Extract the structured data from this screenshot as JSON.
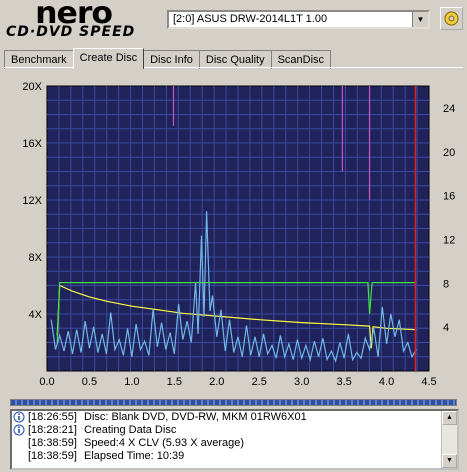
{
  "app": {
    "logo_main": "nero",
    "logo_sub": "CD·DVD SPEED"
  },
  "drive": {
    "selected": "[2:0]  ASUS DRW-2014L1T 1.00"
  },
  "tabs": [
    {
      "label": "Benchmark",
      "active": false
    },
    {
      "label": "Create Disc",
      "active": true
    },
    {
      "label": "Disc Info",
      "active": false
    },
    {
      "label": "Disc Quality",
      "active": false
    },
    {
      "label": "ScanDisc",
      "active": false
    }
  ],
  "chart_data": {
    "type": "line",
    "background": "#20225a",
    "grid": true,
    "x_ticks": [
      "0.0",
      "0.5",
      "1.0",
      "1.5",
      "2.0",
      "2.5",
      "3.0",
      "3.5",
      "4.0",
      "4.5"
    ],
    "y_left_ticks": [
      "4X",
      "8X",
      "12X",
      "16X",
      "20X"
    ],
    "y_right_ticks": [
      "4",
      "8",
      "12",
      "16",
      "20",
      "24"
    ],
    "xlim": [
      0,
      4.5
    ],
    "ylim_left": [
      0,
      20
    ],
    "ylim_right": [
      0,
      26
    ],
    "end_marker_x": 4.34,
    "series": [
      {
        "color": "#ffff40",
        "points": [
          [
            0.12,
            2.5
          ],
          [
            0.15,
            6.0
          ],
          [
            0.3,
            5.6
          ],
          [
            0.5,
            5.2
          ],
          [
            0.7,
            4.9
          ],
          [
            1.0,
            4.55
          ],
          [
            1.3,
            4.3
          ],
          [
            1.6,
            4.05
          ],
          [
            2.0,
            3.85
          ],
          [
            2.5,
            3.6
          ],
          [
            3.0,
            3.4
          ],
          [
            3.5,
            3.25
          ],
          [
            3.8,
            3.15
          ],
          [
            3.82,
            1.6
          ],
          [
            3.84,
            3.1
          ],
          [
            4.0,
            3.0
          ],
          [
            4.35,
            2.9
          ]
        ]
      },
      {
        "color": "#40e040",
        "points": [
          [
            0.12,
            2.0
          ],
          [
            0.15,
            6.2
          ],
          [
            1.0,
            6.2
          ],
          [
            2.0,
            6.2
          ],
          [
            3.0,
            6.2
          ],
          [
            3.5,
            6.2
          ],
          [
            3.78,
            6.2
          ],
          [
            3.8,
            4.0
          ],
          [
            3.83,
            6.2
          ],
          [
            4.35,
            6.2
          ]
        ]
      },
      {
        "color": "#70b8e8",
        "points": [
          [
            0.05,
            3.6
          ],
          [
            0.1,
            1.5
          ],
          [
            0.15,
            2.5
          ],
          [
            0.2,
            1.4
          ],
          [
            0.25,
            2.8
          ],
          [
            0.3,
            1.2
          ],
          [
            0.35,
            2.9
          ],
          [
            0.4,
            1.3
          ],
          [
            0.45,
            3.5
          ],
          [
            0.5,
            1.6
          ],
          [
            0.55,
            3.1
          ],
          [
            0.6,
            1.3
          ],
          [
            0.65,
            2.6
          ],
          [
            0.7,
            1.2
          ],
          [
            0.75,
            4.1
          ],
          [
            0.8,
            1.5
          ],
          [
            0.85,
            2.2
          ],
          [
            0.9,
            1.1
          ],
          [
            0.95,
            3.0
          ],
          [
            1.0,
            1.0
          ],
          [
            1.05,
            3.3
          ],
          [
            1.1,
            1.5
          ],
          [
            1.15,
            2.1
          ],
          [
            1.2,
            1.1
          ],
          [
            1.25,
            4.3
          ],
          [
            1.3,
            1.7
          ],
          [
            1.35,
            3.4
          ],
          [
            1.4,
            1.5
          ],
          [
            1.45,
            2.7
          ],
          [
            1.5,
            1.2
          ],
          [
            1.55,
            4.7
          ],
          [
            1.6,
            2.2
          ],
          [
            1.65,
            3.5
          ],
          [
            1.7,
            2.0
          ],
          [
            1.75,
            6.2
          ],
          [
            1.78,
            2.6
          ],
          [
            1.82,
            9.5
          ],
          [
            1.85,
            3.8
          ],
          [
            1.88,
            11.2
          ],
          [
            1.92,
            4.2
          ],
          [
            1.95,
            5.3
          ],
          [
            2.0,
            2.4
          ],
          [
            2.05,
            4.3
          ],
          [
            2.1,
            1.4
          ],
          [
            2.15,
            3.6
          ],
          [
            2.2,
            1.3
          ],
          [
            2.25,
            2.4
          ],
          [
            2.3,
            1.0
          ],
          [
            2.35,
            3.2
          ],
          [
            2.4,
            1.1
          ],
          [
            2.45,
            2.4
          ],
          [
            2.5,
            1.0
          ],
          [
            2.55,
            2.6
          ],
          [
            2.6,
            1.2
          ],
          [
            2.65,
            1.8
          ],
          [
            2.7,
            0.9
          ],
          [
            2.75,
            2.5
          ],
          [
            2.8,
            1.0
          ],
          [
            2.85,
            1.9
          ],
          [
            2.9,
            0.8
          ],
          [
            2.95,
            2.2
          ],
          [
            3.0,
            0.9
          ],
          [
            3.05,
            1.8
          ],
          [
            3.1,
            0.8
          ],
          [
            3.15,
            2.1
          ],
          [
            3.2,
            1.0
          ],
          [
            3.25,
            2.3
          ],
          [
            3.3,
            0.8
          ],
          [
            3.35,
            1.4
          ],
          [
            3.4,
            0.7
          ],
          [
            3.45,
            2.0
          ],
          [
            3.5,
            0.9
          ],
          [
            3.55,
            2.6
          ],
          [
            3.6,
            0.8
          ],
          [
            3.65,
            1.3
          ],
          [
            3.7,
            0.9
          ],
          [
            3.75,
            2.3
          ],
          [
            3.8,
            1.5
          ],
          [
            3.85,
            3.0
          ],
          [
            3.9,
            1.0
          ],
          [
            3.95,
            4.5
          ],
          [
            4.0,
            1.9
          ],
          [
            4.05,
            4.0
          ],
          [
            4.1,
            2.4
          ],
          [
            4.15,
            3.6
          ],
          [
            4.2,
            1.4
          ],
          [
            4.25,
            2.0
          ],
          [
            4.3,
            1.0
          ],
          [
            4.35,
            1.5
          ]
        ]
      }
    ],
    "spikes": [
      {
        "x": 1.49,
        "top": 20,
        "bottom": 17.2,
        "color": "#d050c0"
      },
      {
        "x": 3.48,
        "top": 20,
        "bottom": 14.0,
        "color": "#d050c0"
      },
      {
        "x": 3.8,
        "top": 20,
        "bottom": 12.0,
        "color": "#d050c0"
      }
    ]
  },
  "log": [
    {
      "icon": "info-icon",
      "time": "[18:26:55]",
      "text": "Disc: Blank DVD, DVD-RW, MKM 01RW6X01"
    },
    {
      "icon": "info-icon",
      "time": "[18:28:21]",
      "text": "Creating Data Disc"
    },
    {
      "icon": "",
      "time": "[18:38:59]",
      "text": "Speed:4 X CLV (5.93 X average)"
    },
    {
      "icon": "",
      "time": "[18:38:59]",
      "text": "Elapsed Time: 10:39"
    }
  ]
}
